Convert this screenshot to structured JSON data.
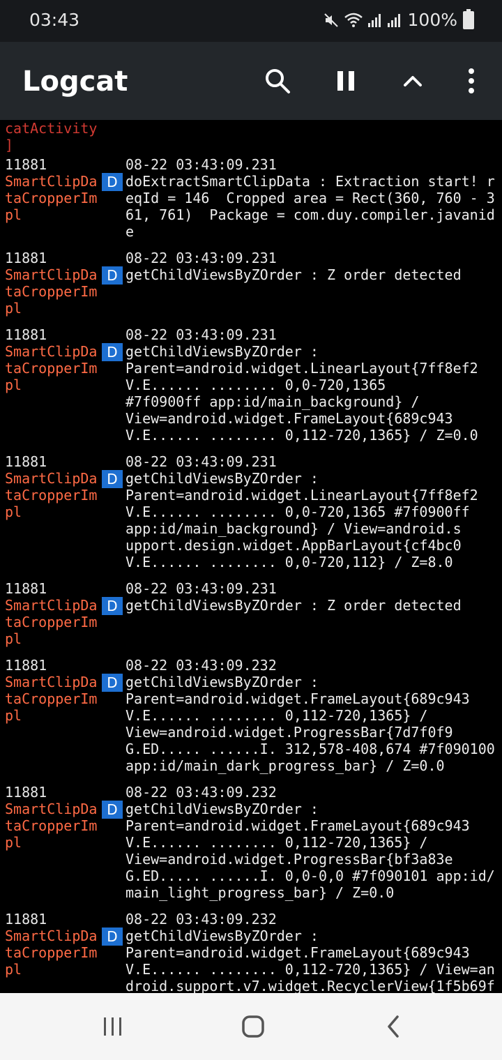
{
  "status_bar": {
    "time": "03:43",
    "battery": "100%",
    "icons": [
      "mute-icon",
      "wifi-icon",
      "signal-icon",
      "signal-icon",
      "battery-icon"
    ]
  },
  "app_bar": {
    "title": "Logcat",
    "actions": [
      "search-icon",
      "pause-icon",
      "chevron-up-icon",
      "more-vert-icon"
    ]
  },
  "log": {
    "top_partial_tag": "catActivity\n]",
    "entries": [
      {
        "pid": "11881",
        "time": "08-22 03:43:09.231",
        "tag": "SmartClipDataCropperImpl",
        "level": "D",
        "message": "doExtractSmartClipData : Extraction start! reqId = 146  Cropped area = Rect(360, 760 - 361, 761)  Package = com.duy.compiler.javanide"
      },
      {
        "pid": "11881",
        "time": "08-22 03:43:09.231",
        "tag": "SmartClipDataCropperImpl",
        "level": "D",
        "message": "getChildViewsByZOrder : Z order detected"
      },
      {
        "pid": "11881",
        "time": "08-22 03:43:09.231",
        "tag": "SmartClipDataCropperImpl",
        "level": "D",
        "message": "getChildViewsByZOrder :\nParent=android.widget.LinearLayout{7ff8ef2\nV.E...... ........ 0,0-720,1365\n#7f0900ff app:id/main_background} /\nView=android.widget.FrameLayout{689c943\nV.E...... ........ 0,112-720,1365} / Z=0.0"
      },
      {
        "pid": "11881",
        "time": "08-22 03:43:09.231",
        "tag": "SmartClipDataCropperImpl",
        "level": "D",
        "message": "getChildViewsByZOrder :\nParent=android.widget.LinearLayout{7ff8ef2\nV.E...... ........ 0,0-720,1365 #7f0900ff\napp:id/main_background} / View=android.s\nupport.design.widget.AppBarLayout{cf4bc0\nV.E...... ........ 0,0-720,112} / Z=8.0"
      },
      {
        "pid": "11881",
        "time": "08-22 03:43:09.231",
        "tag": "SmartClipDataCropperImpl",
        "level": "D",
        "message": "getChildViewsByZOrder : Z order detected"
      },
      {
        "pid": "11881",
        "time": "08-22 03:43:09.232",
        "tag": "SmartClipDataCropperImpl",
        "level": "D",
        "message": "getChildViewsByZOrder :\nParent=android.widget.FrameLayout{689c943\nV.E...... ........ 0,112-720,1365} /\nView=android.widget.ProgressBar{7d7f0f9\nG.ED..... ......I. 312,578-408,674 #7f090100\napp:id/main_dark_progress_bar} / Z=0.0"
      },
      {
        "pid": "11881",
        "time": "08-22 03:43:09.232",
        "tag": "SmartClipDataCropperImpl",
        "level": "D",
        "message": "getChildViewsByZOrder :\nParent=android.widget.FrameLayout{689c943\nV.E...... ........ 0,112-720,1365} /\nView=android.widget.ProgressBar{bf3a83e\nG.ED..... ......I. 0,0-0,0 #7f090101 app:id/\nmain_light_progress_bar} / Z=0.0"
      },
      {
        "pid": "11881",
        "time": "08-22 03:43:09.232",
        "tag": "SmartClipDataCropperImpl",
        "level": "D",
        "message": "getChildViewsByZOrder :\nParent=android.widget.FrameLayout{689c943\nV.E...... ........ 0,112-720,1365} / View=an\ndroid.support.v7.widget.RecyclerView{1f5b69f"
      }
    ]
  },
  "nav_bar": {
    "buttons": [
      "recent-apps-icon",
      "home-icon",
      "back-icon"
    ]
  },
  "colors": {
    "status_bar_bg": "#17191c",
    "app_bar_bg": "#23272b",
    "log_bg": "#000000",
    "tag_color": "#ff6a45",
    "level_badge": "#1d6fd1",
    "nav_bar_bg": "#f5f5f5"
  }
}
